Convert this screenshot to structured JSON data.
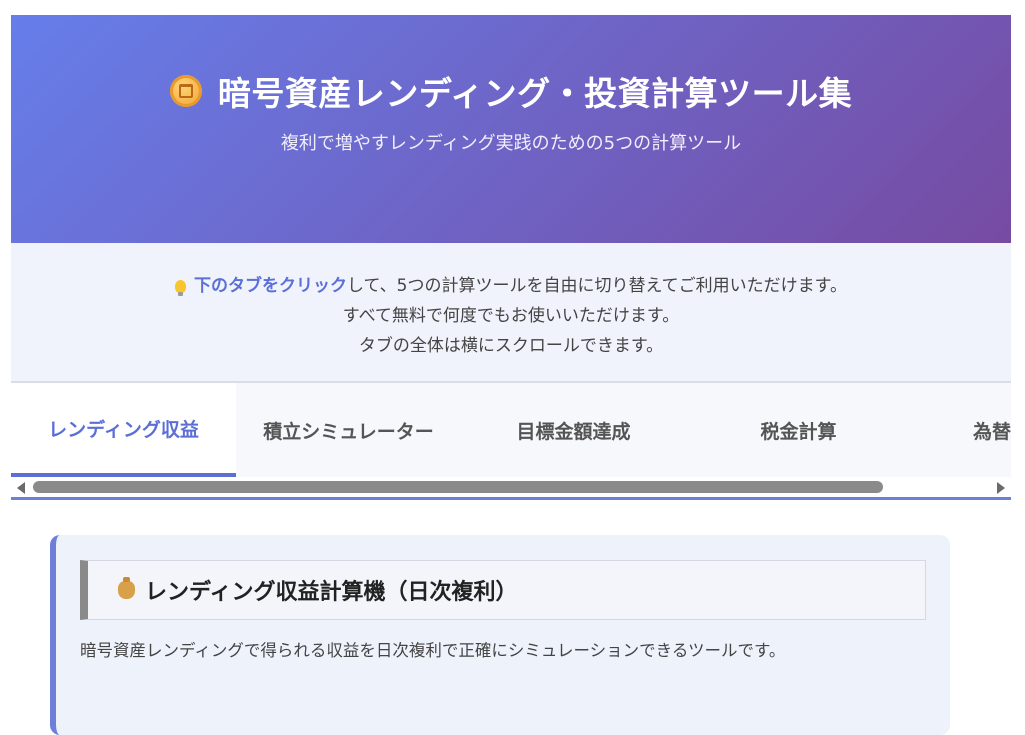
{
  "hero": {
    "title": "暗号資産レンディング・投資計算ツール集",
    "subtitle": "複利で増やすレンディング実践のための5つの計算ツール"
  },
  "hint": {
    "lead_strong": "下のタブをクリック",
    "lead_rest": "して、5つの計算ツールを自由に切り替えてご利用いただけます。",
    "line2": "すべて無料で何度でもお使いいただけます。",
    "line3": "タブの全体は横にスクロールできます。"
  },
  "tabs": [
    {
      "label": "レンディング収益",
      "active": true
    },
    {
      "label": "積立シミュレーター",
      "active": false
    },
    {
      "label": "目標金額達成",
      "active": false
    },
    {
      "label": "税金計算",
      "active": false
    },
    {
      "label": "為替",
      "active": false
    }
  ],
  "card": {
    "title": "レンディング収益計算機（日次複利）",
    "description": "暗号資産レンディングで得られる収益を日次複利で正確にシミュレーションできるツールです。"
  },
  "colors": {
    "accent": "#5b6fd6",
    "hero_start": "#667eea",
    "hero_end": "#764ba2"
  },
  "icons": {
    "title_icon": "coin-icon",
    "hint_icon": "lightbulb-icon",
    "card_icon": "money-bag-icon"
  }
}
